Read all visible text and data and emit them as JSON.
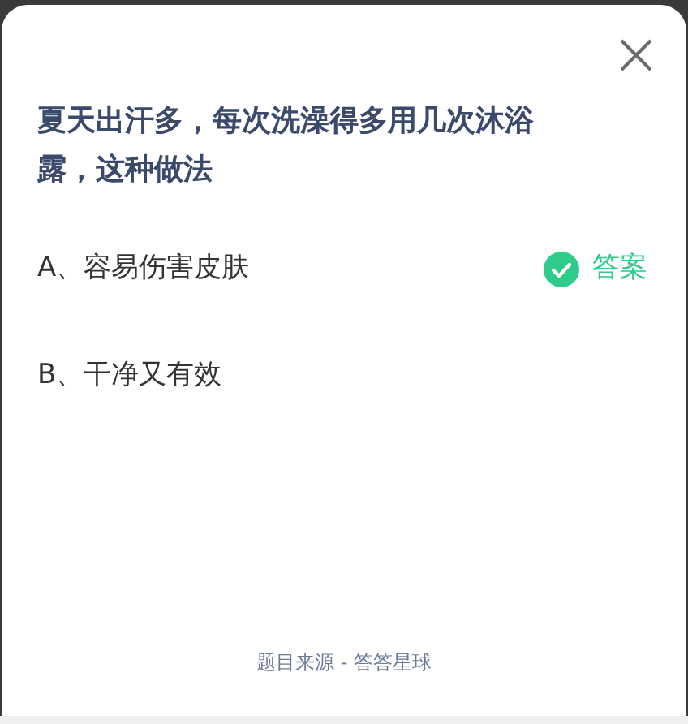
{
  "question": "夏天出汗多，每次洗澡得多用几次沐浴露，这种做法",
  "options": [
    {
      "label": "A、容易伤害皮肤",
      "correct": true,
      "answer_tag": "答案"
    },
    {
      "label": "B、干净又有效",
      "correct": false
    }
  ],
  "source": "题目来源 - 答答星球"
}
